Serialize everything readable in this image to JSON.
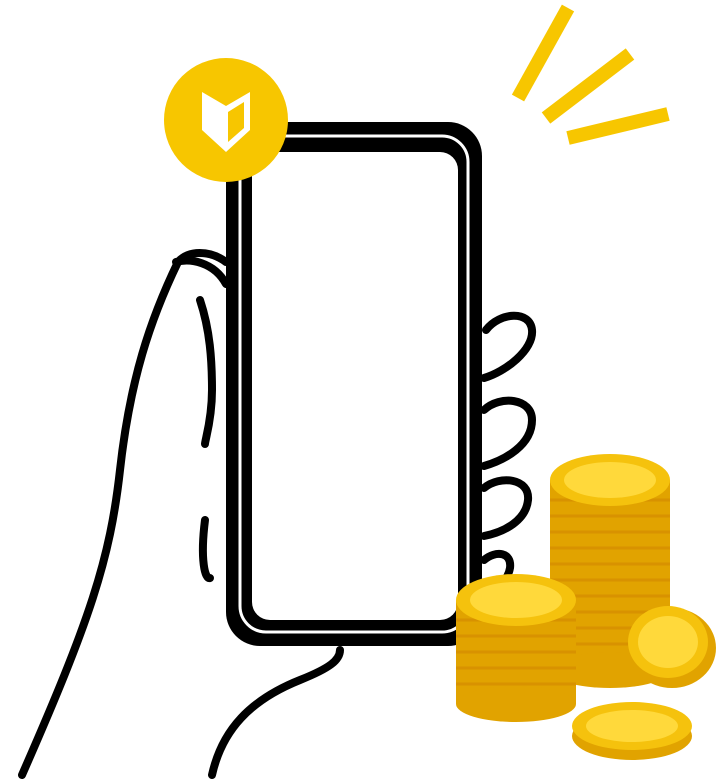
{
  "illustration": {
    "subject": "hand-holding-phone-with-coins",
    "icons": [
      "beginner-mark-icon",
      "coin-stack-icon",
      "coin-icon",
      "sparkle-lines-icon"
    ]
  },
  "colors": {
    "outline": "#000000",
    "screen": "#ffffff",
    "badge": "#f7c600",
    "badge_mark": "#ffffff",
    "accent_lines": "#f7c600",
    "coin_face": "#f5c20d",
    "coin_rim": "#e1a300",
    "coin_shadow": "#d89200",
    "coin_highlight": "#ffd93b"
  }
}
